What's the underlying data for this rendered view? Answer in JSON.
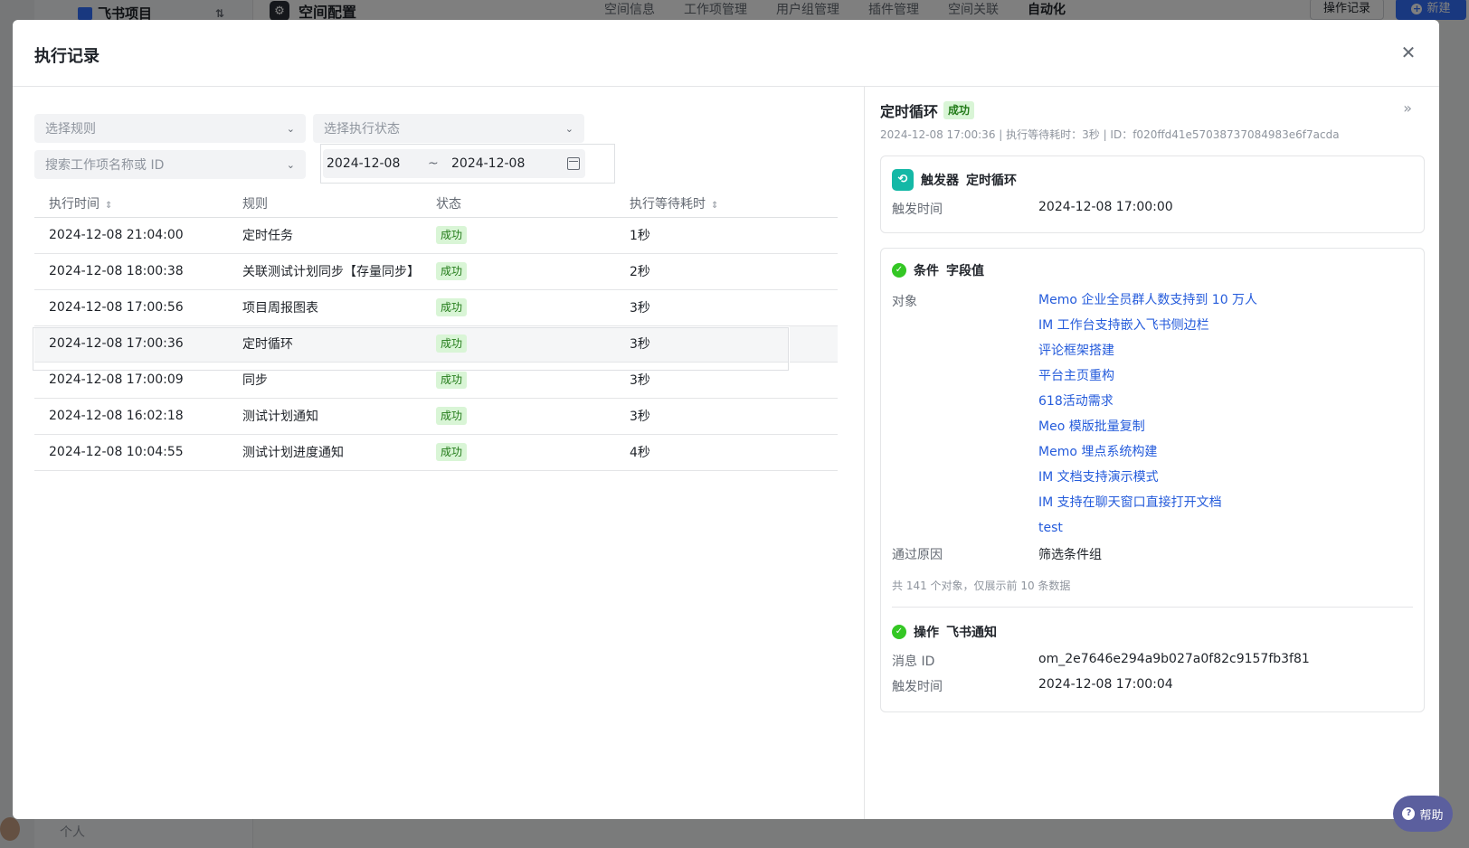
{
  "background": {
    "project_name": "飞书项目",
    "page_title": "空间配置",
    "tabs": [
      "空间信息",
      "工作项管理",
      "用户组管理",
      "插件管理",
      "空间关联",
      "自动化"
    ],
    "oplog_label": "操作记录",
    "new_label": "新建",
    "personal_label": "个人"
  },
  "modal": {
    "title": "执行记录",
    "close_icon": "close-icon",
    "filters": {
      "rule_placeholder": "选择规则",
      "status_placeholder": "选择执行状态",
      "search_placeholder": "搜索工作项名称或 ID",
      "date_from": "2024-12-08",
      "date_sep": "~",
      "date_to": "2024-12-08"
    },
    "table": {
      "headers": [
        "执行时间",
        "规则",
        "状态",
        "执行等待耗时"
      ],
      "rows": [
        {
          "time": "2024-12-08 21:04:00",
          "rule": "定时任务",
          "status": "成功",
          "wait": "1秒"
        },
        {
          "time": "2024-12-08 18:00:38",
          "rule": "关联测试计划同步【存量同步】",
          "status": "成功",
          "wait": "2秒"
        },
        {
          "time": "2024-12-08 17:00:56",
          "rule": "项目周报图表",
          "status": "成功",
          "wait": "3秒"
        },
        {
          "time": "2024-12-08 17:00:36",
          "rule": "定时循环",
          "status": "成功",
          "wait": "3秒"
        },
        {
          "time": "2024-12-08 17:00:09",
          "rule": "同步",
          "status": "成功",
          "wait": "3秒"
        },
        {
          "time": "2024-12-08 16:02:18",
          "rule": "测试计划通知",
          "status": "成功",
          "wait": "3秒"
        },
        {
          "time": "2024-12-08 10:04:55",
          "rule": "测试计划进度通知",
          "status": "成功",
          "wait": "4秒"
        }
      ]
    },
    "detail": {
      "title": "定时循环",
      "status": "成功",
      "meta": "2024-12-08 17:00:36 | 执行等待耗时：3秒 | ID：f020ffd41e57038737084983e6f7acda",
      "trigger": {
        "label": "触发器",
        "name": "定时循环",
        "time_key": "触发时间",
        "time_value": "2024-12-08 17:00:00"
      },
      "condition": {
        "label": "条件",
        "name": "字段值",
        "objects_key": "对象",
        "objects": [
          "Memo 企业全员群人数支持到 10 万人",
          "IM 工作台支持嵌入飞书侧边栏",
          "评论框架搭建",
          "平台主页重构",
          "618活动需求",
          "Meo 模版批量复制",
          "Memo 埋点系统构建",
          "IM 文档支持演示模式",
          "IM 支持在聊天窗口直接打开文档",
          "test"
        ],
        "reason_key": "通过原因",
        "reason_value": "筛选条件组",
        "count_note": "共 141 个对象，仅展示前 10 条数据"
      },
      "action": {
        "label": "操作",
        "name": "飞书通知",
        "msg_key": "消息 ID",
        "msg_value": "om_2e7646e294a9b027a0f82c9157fb3f81",
        "time_key": "触发时间",
        "time_value": "2024-12-08 17:00:04"
      }
    }
  },
  "help_label": "帮助",
  "colors": {
    "accent": "#3370ff",
    "link": "#245bdb",
    "success_bg": "#d9f5d6",
    "success_text": "#237b19"
  }
}
